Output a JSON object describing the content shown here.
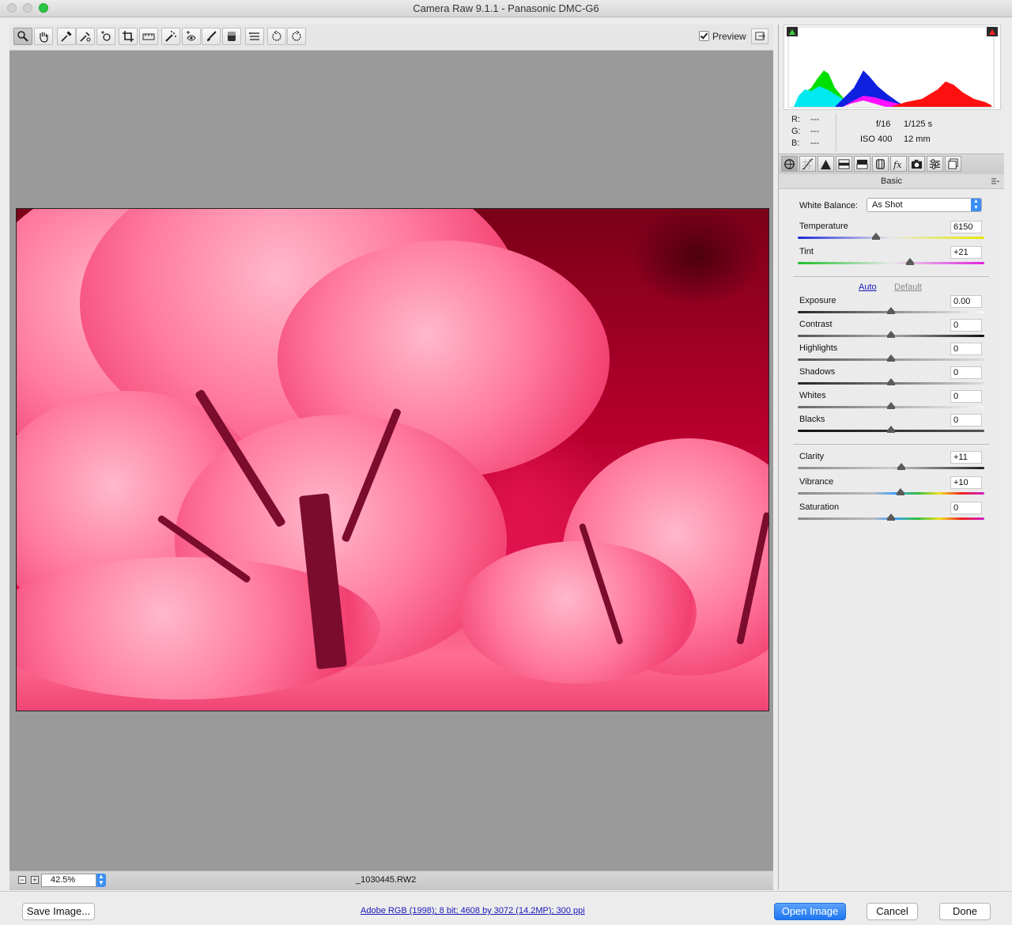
{
  "window": {
    "title": "Camera Raw 9.1.1  -  Panasonic DMC-G6"
  },
  "toolbar": {
    "tools": [
      "zoom-tool-icon",
      "hand-tool-icon",
      "white-balance-tool-icon",
      "color-sampler-tool-icon",
      "targeted-adjustment-tool-icon",
      "crop-tool-icon",
      "straighten-tool-icon",
      "spot-removal-tool-icon",
      "red-eye-removal-tool-icon",
      "adjustment-brush-icon",
      "graduated-filter-icon",
      "preferences-icon",
      "rotate-ccw-icon",
      "rotate-cw-icon"
    ],
    "preview_label": "Preview",
    "preview_checked": true
  },
  "status": {
    "zoom": "42.5%",
    "filename": "_1030445.RW2"
  },
  "histogram": {
    "channels": [
      "red",
      "green",
      "blue",
      "cyan",
      "yellow",
      "magenta",
      "white"
    ]
  },
  "readout": {
    "r_label": "R:",
    "g_label": "G:",
    "b_label": "B:",
    "r_value": "---",
    "g_value": "---",
    "b_value": "---",
    "aperture": "f/16",
    "shutter": "1/125 s",
    "iso": "ISO 400",
    "focal": "12 mm"
  },
  "panel": {
    "tabs": [
      "basic-tab",
      "tone-curve-tab",
      "detail-tab",
      "hsl-tab",
      "split-toning-tab",
      "lens-corrections-tab",
      "effects-tab",
      "camera-calibration-tab",
      "presets-tab",
      "snapshots-tab"
    ],
    "section_title": "Basic",
    "white_balance_label": "White Balance:",
    "white_balance_value": "As Shot",
    "auto_label": "Auto",
    "default_label": "Default",
    "sliders": {
      "temperature": {
        "label": "Temperature",
        "value": "6150",
        "level": 0.42
      },
      "tint": {
        "label": "Tint",
        "value": "+21",
        "level": 0.6
      },
      "exposure": {
        "label": "Exposure",
        "value": "0.00",
        "level": 0.5
      },
      "contrast": {
        "label": "Contrast",
        "value": "0",
        "level": 0.5
      },
      "highlights": {
        "label": "Highlights",
        "value": "0",
        "level": 0.5
      },
      "shadows": {
        "label": "Shadows",
        "value": "0",
        "level": 0.5
      },
      "whites": {
        "label": "Whites",
        "value": "0",
        "level": 0.5
      },
      "blacks": {
        "label": "Blacks",
        "value": "0",
        "level": 0.5
      },
      "clarity": {
        "label": "Clarity",
        "value": "+11",
        "level": 0.555
      },
      "vibrance": {
        "label": "Vibrance",
        "value": "+10",
        "level": 0.55
      },
      "saturation": {
        "label": "Saturation",
        "value": "0",
        "level": 0.5
      }
    }
  },
  "footer": {
    "save_label": "Save Image...",
    "workflow_label": "Adobe RGB (1998); 8 bit; 4608 by 3072 (14.2MP); 300 ppi",
    "open_label": "Open Image",
    "cancel_label": "Cancel",
    "done_label": "Done"
  },
  "colors": {
    "accent": "#1f76f0",
    "photo_tint": "#e01555"
  }
}
